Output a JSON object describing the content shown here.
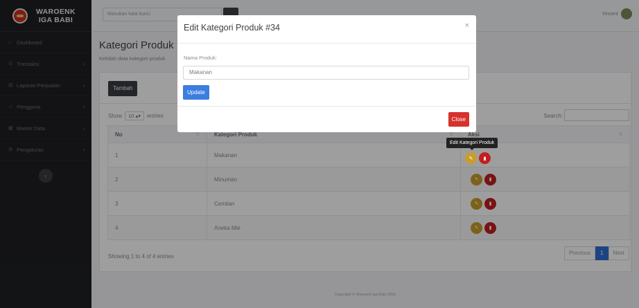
{
  "brand": {
    "line1": "WAROENK",
    "line2": "IGA BABI"
  },
  "sidebar": {
    "items": [
      {
        "icon": "home-icon",
        "glyph": "⌂",
        "label": "Dashboard",
        "arrow": ""
      },
      {
        "icon": "cart-icon",
        "glyph": "☰",
        "label": "Transaksi",
        "arrow": "›"
      },
      {
        "icon": "report-icon",
        "glyph": "▤",
        "label": "Laporan Penjualan",
        "arrow": "›"
      },
      {
        "icon": "users-icon",
        "glyph": "☺",
        "label": "Pengguna",
        "arrow": "›"
      },
      {
        "icon": "database-icon",
        "glyph": "▦",
        "label": "Master Data",
        "arrow": "›"
      },
      {
        "icon": "gear-icon",
        "glyph": "⚙",
        "label": "Pengaturan",
        "arrow": "›"
      }
    ],
    "toggle": "‹"
  },
  "topbar": {
    "search_placeholder": "Masukan kata kunci",
    "user_name": "Vincent"
  },
  "page": {
    "title": "Kategori Produk",
    "subtitle": "Kelolah data kategori produk"
  },
  "card": {
    "add_button": "Tambah",
    "show_label": "Show",
    "entries_value": "10",
    "entries_label": "entries",
    "search_label": "Search:"
  },
  "table": {
    "headers": [
      "No",
      "Kategori Produk",
      "Aksi"
    ],
    "rows": [
      {
        "no": "1",
        "name": "Makanan"
      },
      {
        "no": "2",
        "name": "Minuman"
      },
      {
        "no": "3",
        "name": "Cemilan"
      },
      {
        "no": "4",
        "name": "Aneka Mie"
      }
    ]
  },
  "pagination": {
    "info": "Showing 1 to 4 of 4 entries",
    "prev": "Previous",
    "page": "1",
    "next": "Next"
  },
  "footer": "Copyright © Waroenk Iga Babi 2022",
  "modal": {
    "title": "Edit Kategori Produk #34",
    "close_icon": "×",
    "field_label": "Nama Produk:",
    "field_value": "Makanan",
    "update_button": "Update",
    "close_button": "Close"
  },
  "tooltip": "Edit Kategori Produk",
  "colors": {
    "sidebar": "#1f2023",
    "primary": "#3c7de0",
    "danger": "#d6322e",
    "warning": "#c89d2b"
  }
}
